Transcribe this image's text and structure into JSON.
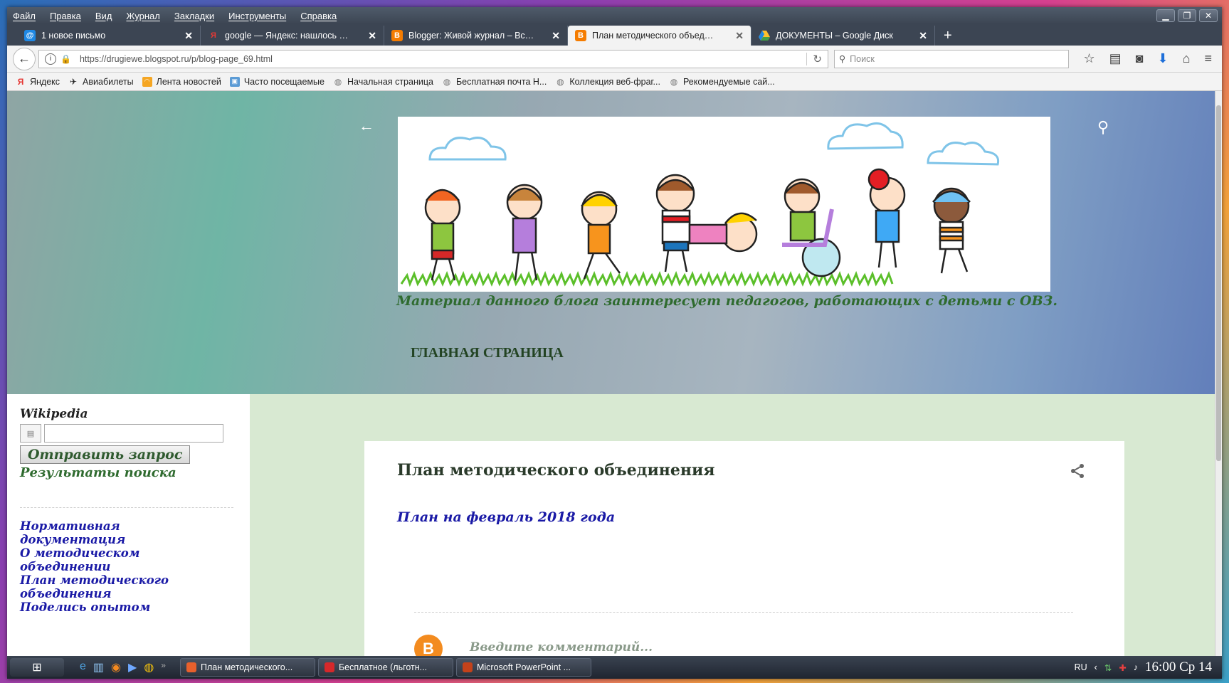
{
  "menu": [
    "Файл",
    "Правка",
    "Вид",
    "Журнал",
    "Закладки",
    "Инструменты",
    "Справка"
  ],
  "tabs": [
    {
      "label": "1 новое письмо",
      "icon": "mail-icon",
      "color": "#1e88e5"
    },
    {
      "label": "google — Яндекс: нашлось …",
      "icon": "yandex-icon",
      "color": "#e53935"
    },
    {
      "label": "Blogger: Живой журнал – Вс…",
      "icon": "blogger-icon",
      "color": "#f57c00"
    },
    {
      "label": "План методического объед…",
      "icon": "blogger-icon",
      "color": "#f57c00"
    },
    {
      "label": "ДОКУМЕНТЫ – Google Диск",
      "icon": "drive-icon",
      "color": "#fbc02d"
    }
  ],
  "nav": {
    "url": "https://drugiewe.blogspot.ru/p/blog-page_69.html",
    "search_placeholder": "Поиск"
  },
  "bookmarks": [
    {
      "label": "Яндекс",
      "icon": "yandex-icon"
    },
    {
      "label": "Авиабилеты",
      "icon": "plane-icon"
    },
    {
      "label": "Лента новостей",
      "icon": "rss-icon"
    },
    {
      "label": "Часто посещаемые",
      "icon": "folder-icon"
    },
    {
      "label": "Начальная страница",
      "icon": "globe-icon"
    },
    {
      "label": "Бесплатная почта Н...",
      "icon": "globe-icon"
    },
    {
      "label": "Коллекция веб-фраг...",
      "icon": "globe-icon"
    },
    {
      "label": "Рекомендуемые сай...",
      "icon": "globe-icon"
    }
  ],
  "blog": {
    "description": "Материал данного блога заинтересует педагогов, работающих с детьми с ОВЗ.",
    "home_link": "ГЛАВНАЯ СТРАНИЦА"
  },
  "sidebar": {
    "wiki_title": "Wikipedia",
    "submit_label": "Отправить запрос",
    "results_label": "Результаты поиска",
    "links": [
      "Нормативная документация",
      "О методическом объединении",
      "План методического объединения",
      "Поделись опытом"
    ]
  },
  "post": {
    "title": "План методического объединения",
    "link": "План на февраль 2018 года",
    "comment_placeholder": "Введите комментарий..."
  },
  "taskbar": {
    "tasks": [
      {
        "label": "План методического...",
        "color": "#e8602c"
      },
      {
        "label": "Бесплатное (льготн...",
        "color": "#d6282a"
      },
      {
        "label": "Microsoft PowerPoint ...",
        "color": "#c4421a"
      }
    ],
    "lang": "RU",
    "clock": "16:00 Ср 14"
  },
  "colors": {
    "accent_green": "#2f6b2f",
    "link_blue": "#1a1aa6",
    "lower_bg": "#d8e9d2"
  }
}
